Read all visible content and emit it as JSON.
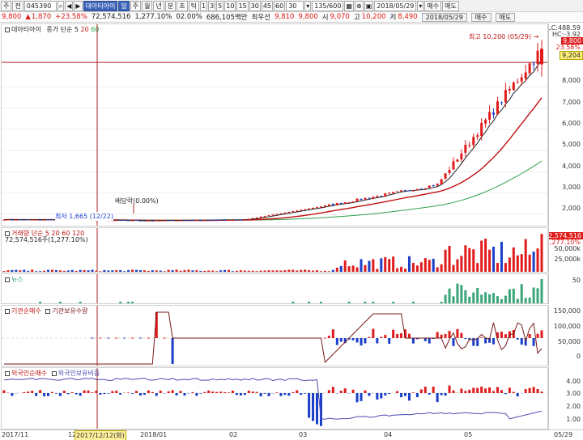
{
  "toolbar": {
    "menu1": "주",
    "menu2": "전",
    "code": "045390",
    "name": "대아티아이",
    "periods": [
      "일",
      "주",
      "월",
      "년",
      "분",
      "초",
      "틱"
    ],
    "intervals": [
      "1",
      "3",
      "5",
      "10",
      "15",
      "30",
      "45",
      "60"
    ],
    "count_select": "30",
    "range": "135/600",
    "date": "2018/05/29",
    "buy": "매수",
    "sell": "매도"
  },
  "quote": {
    "price": "9,800",
    "change": "1,870",
    "change_pct": "+23.58%",
    "volume": "72,574,516",
    "vol_ratio": "1,277.10%",
    "sub_pct": "02.00%",
    "amount": "686,105백만",
    "high_label": "최우선",
    "high_val": "9,810",
    "bid": "9,800",
    "label_si": "시",
    "open": "9,070",
    "label_go": "고",
    "hi": "10,200",
    "label_jeo": "저",
    "lo": "8,490"
  },
  "colors": {
    "up": "#e01b1b",
    "down": "#1b3fc8",
    "ma5": "#222222",
    "ma20": "#c01010",
    "ma60": "#2fa04a",
    "news": "#3aa67a",
    "cross": "#b02020"
  },
  "price_panel": {
    "legend_name": "대아티아이",
    "legend_ma": "종가 단순",
    "ma_labels": [
      "5",
      "20",
      "60"
    ],
    "lc": "LC:488.59",
    "hc": "HC:-3.92",
    "current": "9,800",
    "current_pct": "23.58%",
    "ref_price": "9,204",
    "high_note": "최고 10,200 (05/29) →",
    "low_note": "최저 1,665 (12/22)",
    "div_note": "배당락(0.00%)",
    "ticks": [
      "8,000",
      "7,000",
      "6,000",
      "5,000",
      "4,000",
      "3,000",
      "2,000"
    ]
  },
  "volume_panel": {
    "legend": "거래량 단순 5 20 60 120",
    "sub": "72,574,516주(1,277.10%)",
    "flag_value": "72,574,516",
    "flag_pct": "1,277.10%",
    "ticks": [
      "50,000k",
      "25,000k"
    ]
  },
  "news_panel": {
    "legend": "뉴스",
    "ticks": [
      "50"
    ]
  },
  "inst_panel": {
    "legend1": "기관순매수",
    "legend2": "기관보유수량",
    "ticks": [
      "150,000",
      "100,000",
      "50,000",
      "0"
    ]
  },
  "foreign_panel": {
    "legend1": "외국인순매수",
    "legend2": "외국인보유비중",
    "ticks": [
      "4.00",
      "3.00",
      "2.00",
      "1.00"
    ]
  },
  "date_axis": {
    "labels": [
      "2017/11",
      "12",
      "2017/12/12(화)",
      "2018/01",
      "02",
      "03",
      "04",
      "05",
      "05/29"
    ]
  },
  "chart_data": {
    "type": "candlestick",
    "title": "대아티아이 (045390)",
    "xlabel": "",
    "ylabel": "",
    "ylim": [
      1500,
      10500
    ],
    "anchors": [
      {
        "period": "2017/11",
        "close": 1750
      },
      {
        "period": "2018/01",
        "close": 1700
      },
      {
        "period": "2018/02",
        "close": 1750
      },
      {
        "period": "2018/03",
        "close": 2500
      },
      {
        "period": "2018/04",
        "close": 3400
      },
      {
        "period": "2018/05",
        "close": 7400
      },
      {
        "period": "2018/05/29",
        "close": 9800
      }
    ],
    "series": [
      {
        "name": "5",
        "type": "line"
      },
      {
        "name": "20",
        "type": "line"
      },
      {
        "name": "60",
        "type": "line"
      }
    ],
    "high": {
      "value": 10200,
      "date": "05/29"
    },
    "low": {
      "value": 1665,
      "date": "12/22"
    }
  }
}
